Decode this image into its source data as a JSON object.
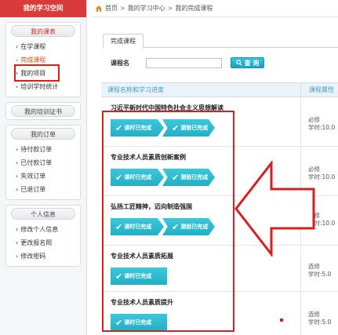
{
  "sidebar": {
    "header": "我的学习空间",
    "sections": [
      {
        "title": "我的课表",
        "items": [
          {
            "label": "在学课程",
            "active": false
          },
          {
            "label": "完成课程",
            "active": true
          },
          {
            "label": "我的项目",
            "active": false
          },
          {
            "label": "培训学时统计",
            "active": false
          }
        ]
      },
      {
        "title": "我的培训证书",
        "items": []
      },
      {
        "title": "我的订单",
        "items": [
          {
            "label": "待付款订单"
          },
          {
            "label": "已付款订单"
          },
          {
            "label": "失效订单"
          },
          {
            "label": "已退订单"
          }
        ]
      },
      {
        "title": "个人信息",
        "items": [
          {
            "label": "修改个人信息"
          },
          {
            "label": "更改报名照"
          },
          {
            "label": "修改密码"
          }
        ]
      }
    ]
  },
  "breadcrumb": {
    "home": "首页",
    "level2": "我的学习中心",
    "level3": "我的完成课程"
  },
  "tab": {
    "label": "完成课程"
  },
  "search": {
    "label": "课程名",
    "button": "查 询",
    "value": ""
  },
  "table": {
    "col1": "课程名称和学习进度",
    "col2": "课程属性",
    "rows": [
      {
        "title": "习近平新时代中国特色社会主义思想解读",
        "badges": [
          "课时已完成",
          "测验已完成"
        ],
        "attr1": "必修",
        "attr2": "学时:10.0"
      },
      {
        "title": "专业技术人员素质创新案例",
        "badges": [
          "课时已完成",
          "测验已完成"
        ],
        "attr1": "必修",
        "attr2": "学时:10.0"
      },
      {
        "title": "弘扬工匠精神，迈向制造强国",
        "badges": [
          "课时已完成",
          "测验已完成"
        ],
        "attr1": "必修",
        "attr2": "学时:10.0"
      },
      {
        "title": "专业技术人员素质拓展",
        "badges": [
          "课时已完成"
        ],
        "attr1": "选修",
        "attr2": "学时:5.0"
      },
      {
        "title": "专业技术人员素质提升",
        "badges": [
          "课时已完成"
        ],
        "attr1": "选修",
        "attr2": "学时:5.0"
      }
    ]
  },
  "colors": {
    "sidebar_header": "#d93a3a",
    "badge": "#2bb8cc",
    "highlight": "#d42020",
    "active_link": "#e04a18"
  }
}
